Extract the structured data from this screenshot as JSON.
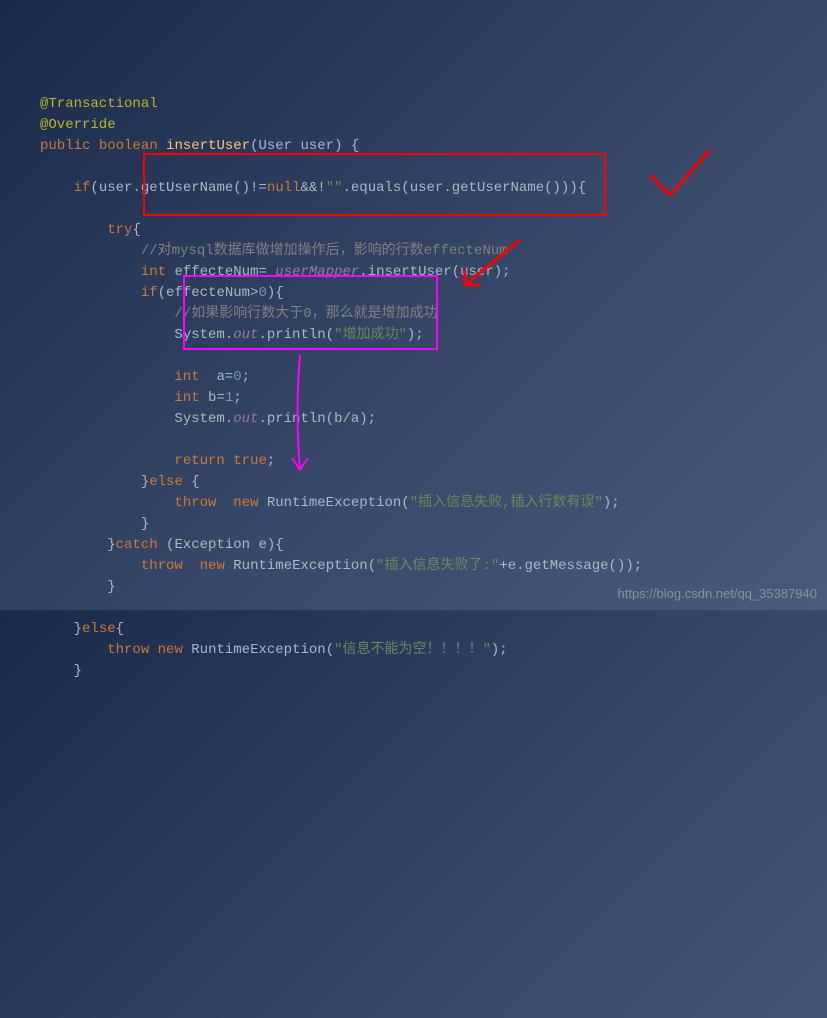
{
  "code": {
    "l1": "@Transactional",
    "l2": "@Override",
    "l3_kw1": "public",
    "l3_kw2": "boolean",
    "l3_fn": "insertUser",
    "l3_rest": "(User user) {",
    "l4_kw": "if",
    "l4_rest1": "(user.getUserName()!=",
    "l4_kw2": "null",
    "l4_rest2": "&&!",
    "l4_str": "\"\"",
    "l4_rest3": ".equals(user.getUserName())){",
    "l5_kw": "try",
    "l5_rest": "{",
    "l6": "//对mysql数据库做增加操作后，影响的行数effecteNum",
    "l7_kw": "int",
    "l7_var": "effecteNum",
    "l7_eq": "= ",
    "l7_fld": "userMapper",
    "l7_rest": ".insertUser(user);",
    "l8_kw": "if",
    "l8_op": "(",
    "l8_var": "effecteNum",
    "l8_gt": ">",
    "l8_num": "0",
    "l8_rest": "){",
    "l9": "//如果影响行数大于0，那么就是增加成功",
    "l10_a": "System.",
    "l10_fld": "out",
    "l10_b": ".println(",
    "l10_str": "\"增加成功\"",
    "l10_c": ");",
    "l11_kw": "int",
    "l11_sp": "  a=",
    "l11_num": "0",
    "l11_end": ";",
    "l12_kw": "int",
    "l12_sp": " b=",
    "l12_num": "1",
    "l12_end": ";",
    "l13_a": "System.",
    "l13_fld": "out",
    "l13_b": ".println(b/a);",
    "l14_kw": "return",
    "l14_val": "true",
    "l14_end": ";",
    "l15_a": "}",
    "l15_kw": "else",
    "l15_b": " {",
    "l16_kw1": "throw",
    "l16_kw2": "new",
    "l16_cls": "RuntimeException",
    "l16_op": "(",
    "l16_str": "\"插入信息失败,插入行数有误\"",
    "l16_end": ");",
    "l17": "}",
    "l18_a": "}",
    "l18_kw": "catch",
    "l18_b": " (Exception e){",
    "l19_kw1": "throw",
    "l19_kw2": "new",
    "l19_cls": "RuntimeException",
    "l19_op": "(",
    "l19_str": "\"插入信息失败了:\"",
    "l19_rest": "+e.getMessage());",
    "l20": "}",
    "l21_a": "}",
    "l21_kw": "else",
    "l21_b": "{",
    "l22_kw1": "throw",
    "l22_kw2": "new",
    "l22_cls": "RuntimeException",
    "l22_op": "(",
    "l22_str": "\"信息不能为空！！！！\"",
    "l22_end": ");",
    "l23": "}"
  },
  "watermark": "https://blog.csdn.net/qq_35387940"
}
